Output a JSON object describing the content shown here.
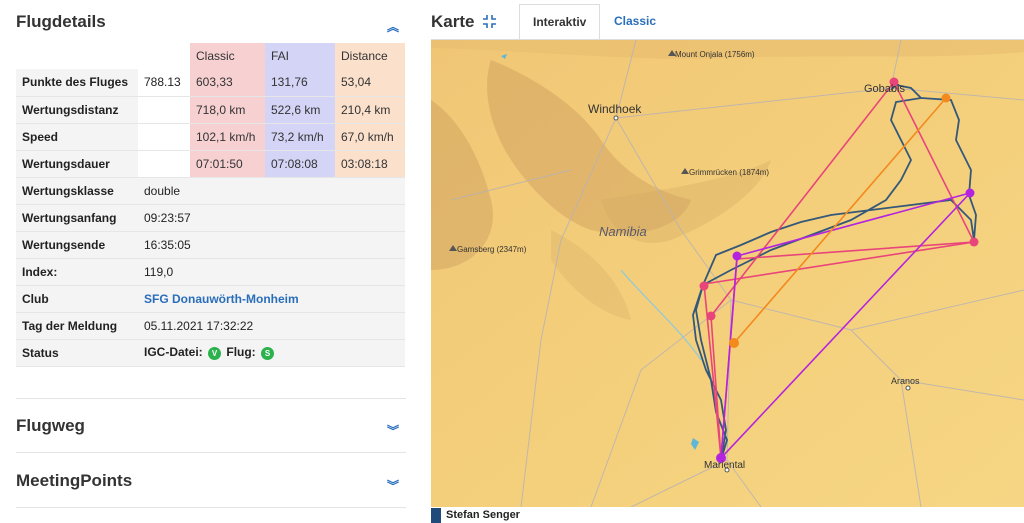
{
  "flugdetails": {
    "title": "Flugdetails",
    "headers": {
      "classic": "Classic",
      "fai": "FAI",
      "distance": "Distance"
    },
    "score_rows": [
      {
        "label": "Punkte des Fluges",
        "value": "788.13",
        "classic": "603,33",
        "fai": "131,76",
        "distance": "53,04"
      },
      {
        "label": "Wertungsdistanz",
        "value": "",
        "classic": "718,0 km",
        "fai": "522,6 km",
        "distance": "210,4 km"
      },
      {
        "label": "Speed",
        "value": "",
        "classic": "102,1 km/h",
        "fai": "73,2 km/h",
        "distance": "67,0 km/h"
      },
      {
        "label": "Wertungsdauer",
        "value": "",
        "classic": "07:01:50",
        "fai": "07:08:08",
        "distance": "03:08:18"
      }
    ],
    "info_rows": [
      {
        "label": "Wertungsklasse",
        "value": "double"
      },
      {
        "label": "Wertungsanfang",
        "value": "09:23:57"
      },
      {
        "label": "Wertungsende",
        "value": "16:35:05"
      },
      {
        "label": "Index:",
        "value": "119,0"
      },
      {
        "label": "Club",
        "value": "SFG Donauwörth-Monheim"
      },
      {
        "label": "Tag der Meldung",
        "value": "05.11.2021 17:32:22"
      }
    ],
    "status": {
      "label": "Status",
      "igc_label": "IGC-Datei:",
      "igc_badge": "V",
      "flug_label": "Flug:",
      "flug_badge": "S"
    }
  },
  "flugweg": {
    "title": "Flugweg"
  },
  "meetingpoints": {
    "title": "MeetingPoints"
  },
  "karte": {
    "title": "Karte",
    "tabs": {
      "active": "Interaktiv",
      "inactive": "Classic"
    },
    "labels": {
      "mount_onjala": "Mount Onjala (1756m)",
      "windhoek": "Windhoek",
      "gobabis": "Gobabis",
      "grimmruecken": "Grimmrücken (1874m)",
      "namibia": "Namibia",
      "gamsberg": "Gamsberg (2347m)",
      "aranos": "Aranos",
      "mariental": "Mariental"
    },
    "colors": {
      "track": "#1f4a7a",
      "classic": "#e8457a",
      "fai": "#b424e0",
      "distance": "#f28a1e"
    }
  },
  "legend": {
    "pilot": "Stefan Senger"
  }
}
